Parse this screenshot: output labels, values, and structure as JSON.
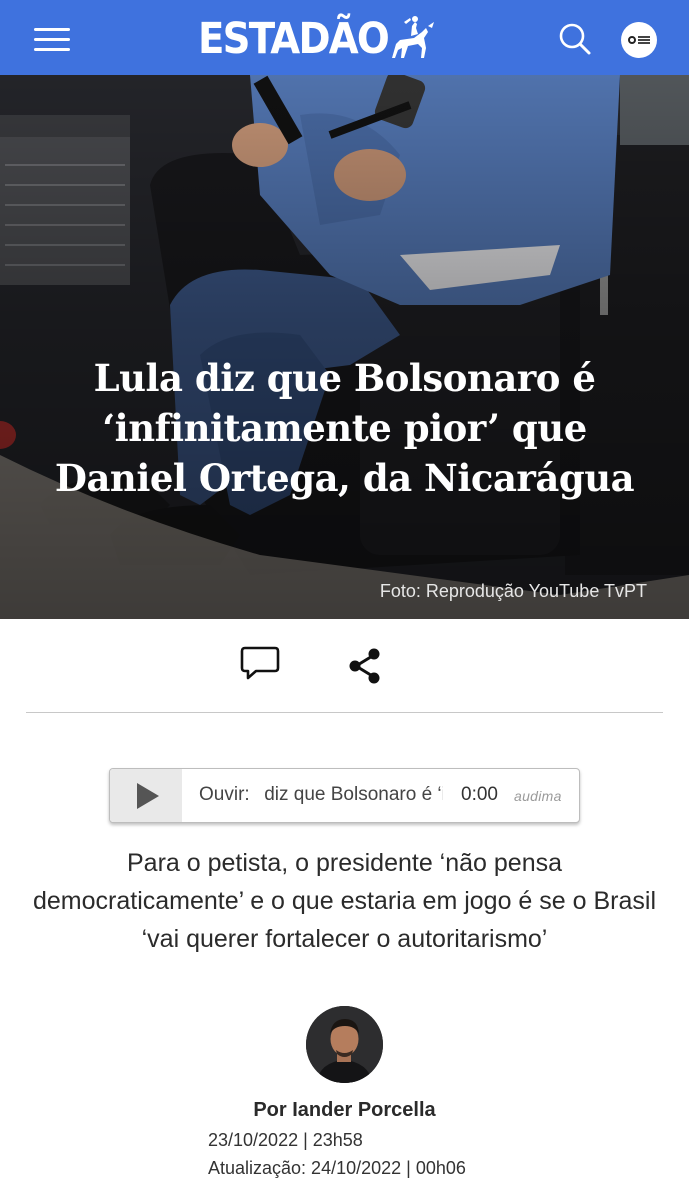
{
  "header": {
    "logo_text": "ESTADÃO",
    "menu_icon": "hamburger-menu-icon",
    "search_icon": "search-icon",
    "profile_icon": "profile-icon",
    "background_color": "#3f72de"
  },
  "hero": {
    "headline": "Lula diz que Bolsonaro é ‘infinitamente pior’ que Daniel Ortega, da Nicarágua",
    "photo_credit": "Foto: Reprodução YouTube TvPT"
  },
  "actions": {
    "comment_icon": "comment-icon",
    "share_icon": "share-icon"
  },
  "audio_player": {
    "play_icon": "play-icon",
    "label": "Ouvir:",
    "title": "Lula diz que Bolsonaro é ‘infinitamente pior’ que Daniel Ortega, da Nicarágua",
    "time": "0:00",
    "brand": "audima"
  },
  "article": {
    "subtitle": "Para o petista, o presidente ‘não pensa democraticamente’ e o que estaria em jogo é se o Brasil ‘vai querer fortalecer o autoritarismo’",
    "author": "Por Iander Porcella",
    "published": "23/10/2022 | 23h58",
    "updated": "Atualização: 24/10/2022 | 00h06"
  }
}
